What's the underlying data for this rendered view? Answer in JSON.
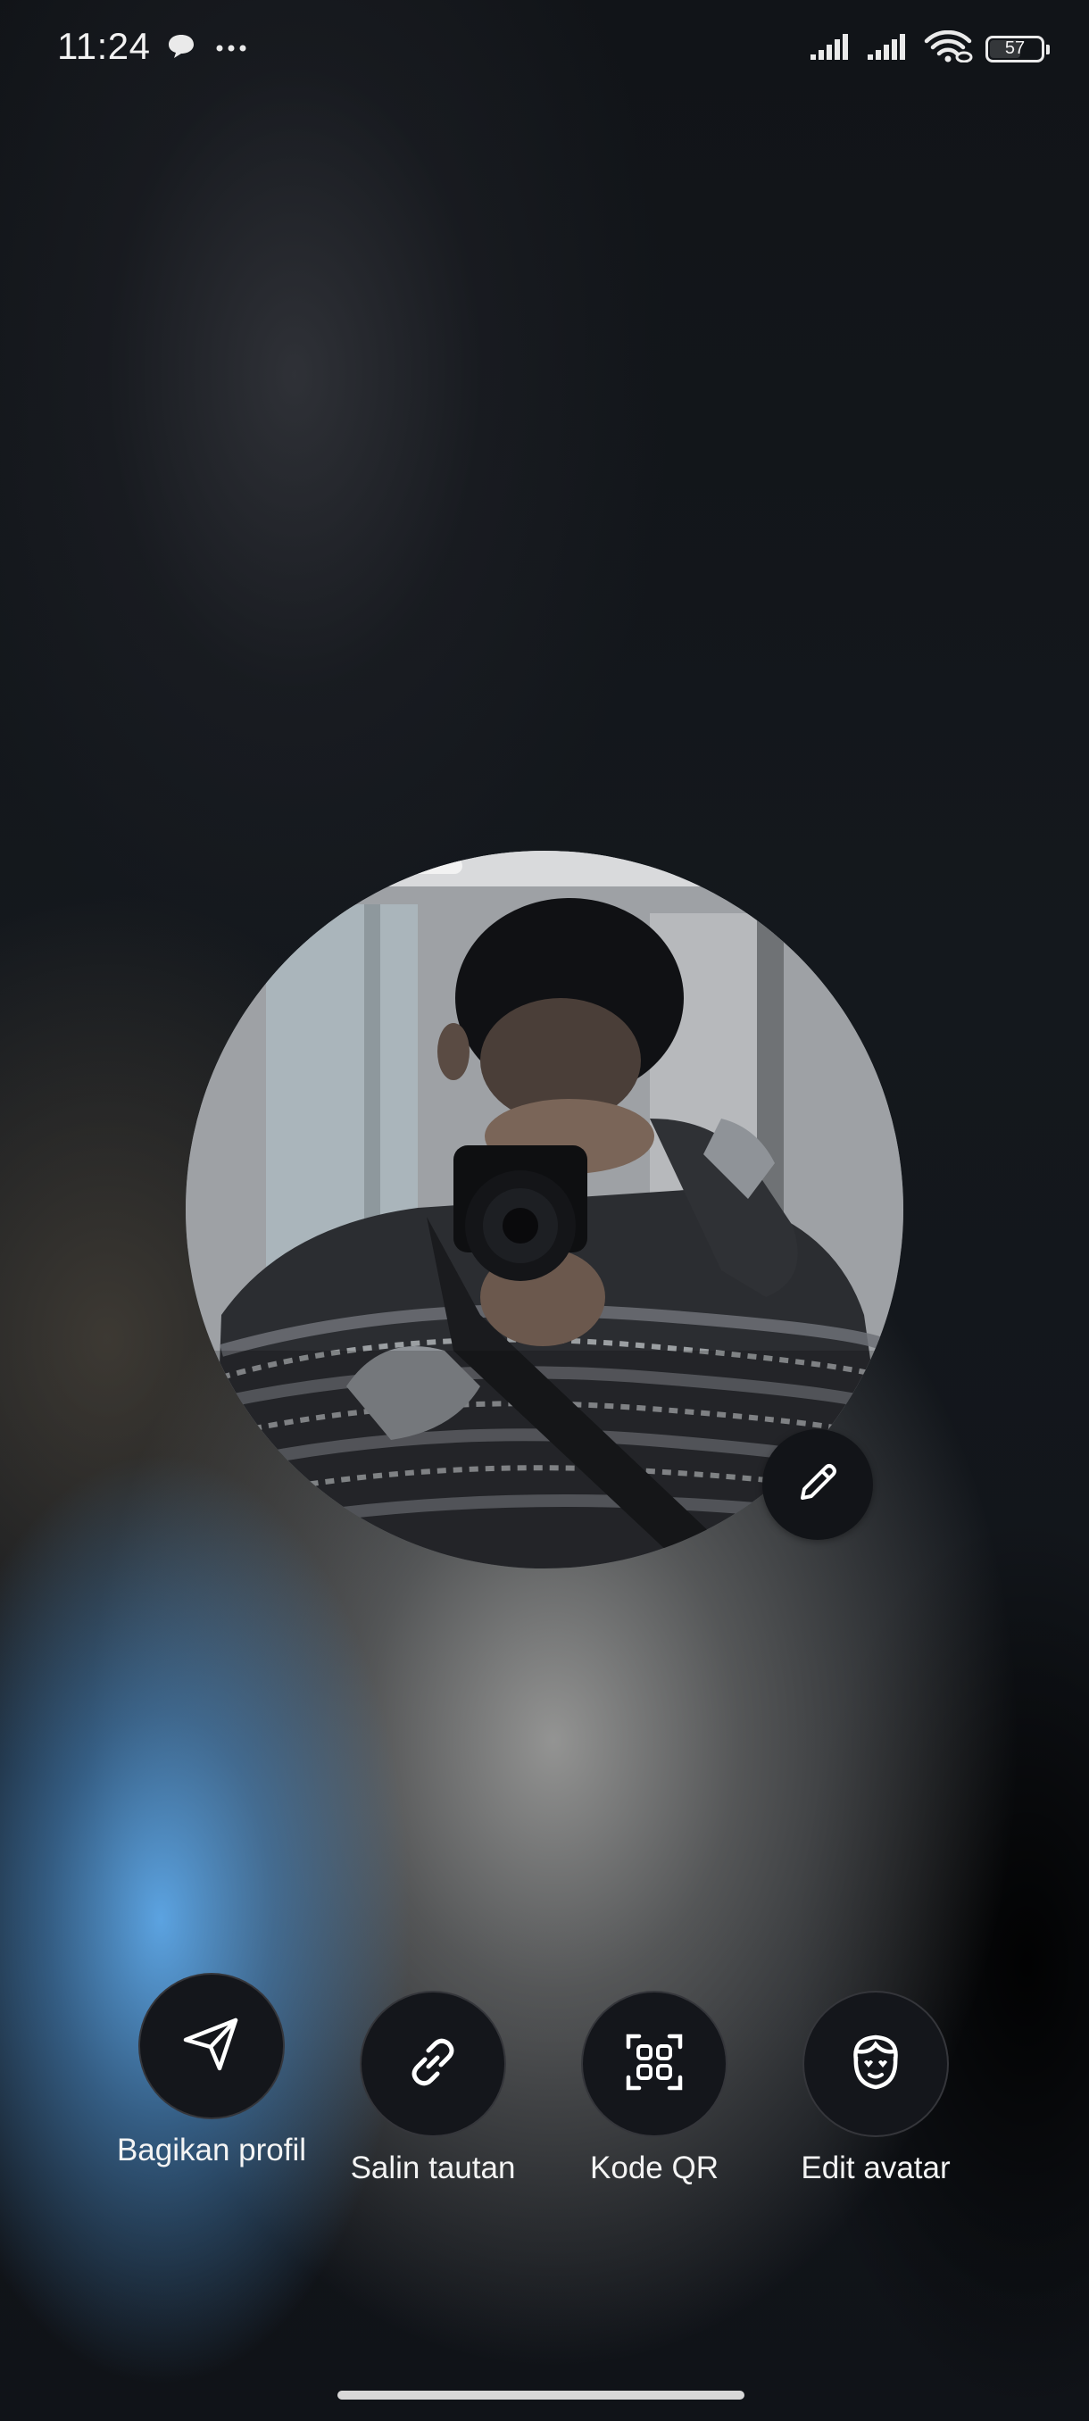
{
  "status_bar": {
    "time": "11:24",
    "battery_level": "57"
  },
  "profile": {
    "avatar_icon": "profile-photo",
    "edit_icon": "pencil-icon"
  },
  "actions": [
    {
      "label": "Bagikan profil",
      "icon": "send-icon"
    },
    {
      "label": "Salin tautan",
      "icon": "link-icon"
    },
    {
      "label": "Kode QR",
      "icon": "qr-code-icon"
    },
    {
      "label": "Edit avatar",
      "icon": "avatar-face-icon"
    }
  ],
  "colors": {
    "button_bg": "#14161b",
    "accent_blue": "#5faaeb"
  }
}
